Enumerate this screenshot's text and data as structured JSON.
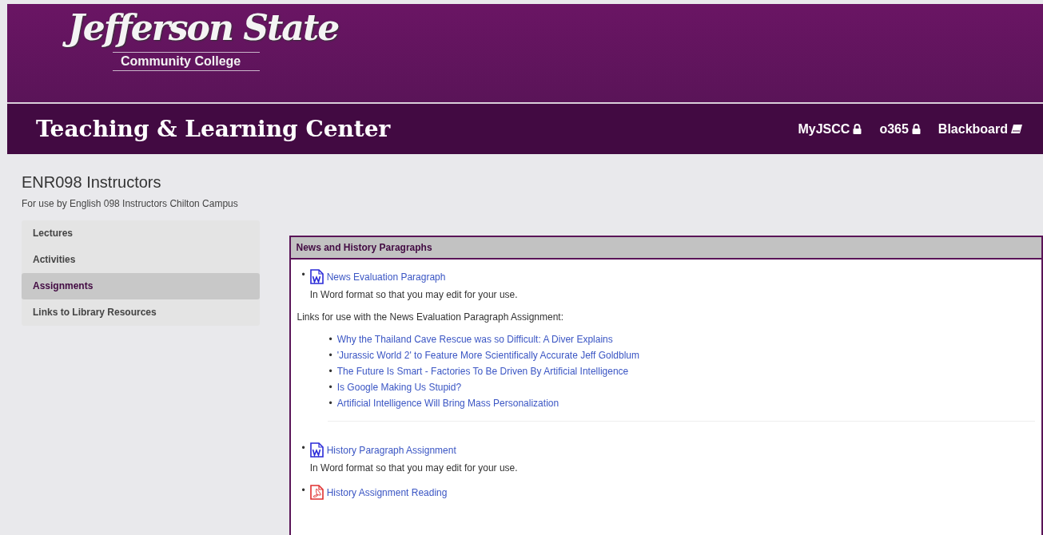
{
  "header": {
    "logo": {
      "script": "Jefferson State",
      "subtitle": "Community College"
    },
    "title": "Teaching & Learning Center",
    "nav": [
      {
        "label": "MyJSCC",
        "kind": "lock"
      },
      {
        "label": "o365",
        "kind": "lock"
      },
      {
        "label": "Blackboard",
        "kind": "book"
      }
    ]
  },
  "page": {
    "title": "ENR098 Instructors",
    "subtitle": "For use by English 098 Instructors Chilton Campus"
  },
  "sidebar": {
    "items": [
      {
        "label": "Lectures",
        "selected": false
      },
      {
        "label": "Activities",
        "selected": false
      },
      {
        "label": "Assignments",
        "selected": true
      },
      {
        "label": "Links to Library Resources",
        "selected": false
      }
    ]
  },
  "panel": {
    "title": "News and History Paragraphs",
    "blocks": [
      {
        "kind": "word_file",
        "marker": "•",
        "link": "News Evaluation Paragraph",
        "note": "In Word format so that you may edit for your use."
      },
      {
        "kind": "text",
        "text": "Links for use with the News Evaluation Paragraph Assignment:"
      },
      {
        "kind": "links",
        "links": [
          {
            "marker": "•",
            "label": "Why the Thailand Cave Rescue was so Difficult: A Diver Explains"
          },
          {
            "marker": "•",
            "label": "'Jurassic World 2' to Feature More Scientifically Accurate Jeff Goldblum"
          },
          {
            "marker": "•",
            "label": "The Future Is Smart - Factories To Be Driven By Artificial Intelligence"
          },
          {
            "marker": "•",
            "label": "Is Google Making Us Stupid?"
          },
          {
            "marker": "•",
            "label": "Artificial Intelligence Will Bring Mass Personalization"
          }
        ]
      },
      {
        "kind": "divider"
      },
      {
        "kind": "word_file",
        "marker": "•",
        "link": "History Paragraph Assignment",
        "note": "In Word format so that you may edit for your use."
      },
      {
        "kind": "pdf_file",
        "marker": "•",
        "link": "History Assignment Reading"
      }
    ]
  }
}
